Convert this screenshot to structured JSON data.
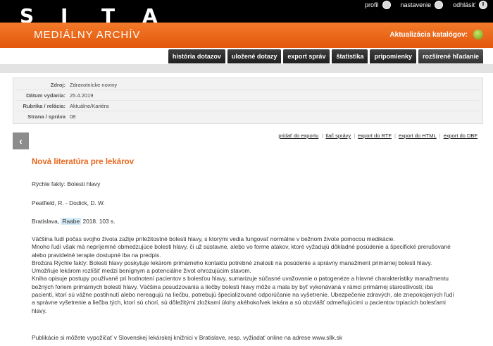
{
  "header": {
    "logo_letters": [
      "S",
      "I",
      "T",
      "A"
    ],
    "nav": [
      {
        "label": "profil",
        "icon": "user-icon"
      },
      {
        "label": "nastavenie",
        "icon": "wrench-icon"
      },
      {
        "label": "odhlásiť",
        "icon": "power-icon"
      }
    ]
  },
  "band": {
    "title": "MEDIÁLNY ARCHÍV",
    "update_label": "Aktualizácia katalógov:",
    "status_color": "#6f9a12"
  },
  "tabs": [
    {
      "label": "história dotazov"
    },
    {
      "label": "uložené dotazy"
    },
    {
      "label": "export správ"
    },
    {
      "label": "štatistika"
    },
    {
      "label": "pripomienky"
    },
    {
      "label": "rozšírené hľadanie"
    }
  ],
  "meta": [
    {
      "key": "Zdroj:",
      "value": "Zdravotnícke noviny"
    },
    {
      "key": "Dátum vydania:",
      "value": "25.4.2019"
    },
    {
      "key": "Rubrika / relácia:",
      "value": "Aktuálne/Kariéra"
    },
    {
      "key": "Strana / správa",
      "value": "08"
    }
  ],
  "back_label": "‹",
  "exports": [
    {
      "label": "pridať do exportu"
    },
    {
      "label": "tlač správy"
    },
    {
      "label": "export do RTF"
    },
    {
      "label": "export do HTML"
    },
    {
      "label": "export do DBF"
    }
  ],
  "article": {
    "title": "Nová literatúra pre lekárov",
    "p1": "Rýchle fakty: Bolesti hlavy",
    "p2": "Peatfield, R. - Dodick, D. W.",
    "p3_before": "Bratislava,",
    "p3_highlight": "Raabe",
    "p3_after": "2018. 103 s.",
    "p4_lines": [
      "Väčšina ľudí počas svojho života zažije príležitostné bolesti hlavy, s ktorými vedia fungovať normálne v bežnom živote pomocou medikácie.",
      "Mnoho ľudí však má nepríjemné obmedzujúce bolesti hlavy, či už sústavne, alebo vo forme atakov, ktoré vyžadujú dôkladné posúdenie a špecifické prerušované",
      "alebo pravidelné terapie dostupné iba na predpis.",
      "Brožúra Rýchle fakty: Bolesti hlavy poskytuje lekárom primárneho kontaktu potrebné znalosti na posúdenie a správny manažment primárnej bolesti hlavy.",
      "Umožňuje lekárom rozlíšiť medzi benígnym a potenciálne život ohrozujúcim stavom.",
      "Kniha opisuje postupy používané pri hodnotení pacientov s bolesťou hlavy, sumarizuje súčasné uvažovanie o patogenéze a hlavné charakteristiky manažmentu",
      "bežných foriem primárnych bolestí hlavy. Väčšina posudzovania a liečby bolesti hlavy môže a mala by byť vykonávaná v rámci primárnej starostlivosti; iba",
      "pacienti, ktorí sú vážne postihnutí alebo nereagujú na liečbu, potrebujú špecializované odporúčanie na vyšetrenie. Ubezpečenie zdravých, ale znepokojených ľudí",
      "a správne vyšetrenie a liečba tých, ktorí sú chorí, sú dôležitými zložkami úlohy akéhokoľvek lekára a sú obzvlášť odmeňujúcimi u pacientov trpiacich bolesťami",
      "hlavy."
    ],
    "p5": "Publikácie si môžete vypožičať v Slovenskej lekárskej knižnici v Bratislave, resp. vyžiadať online na adrese www.sllk.sk"
  }
}
